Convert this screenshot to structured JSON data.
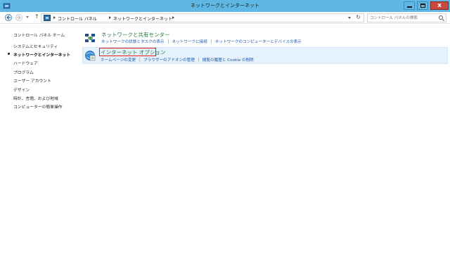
{
  "window": {
    "title": "ネットワークとインターネット",
    "close_label": "x"
  },
  "address": {
    "crumbs": [
      "コントロール パネル",
      "ネットワークとインターネット"
    ],
    "search_placeholder": "コントロール パネルの検索"
  },
  "sidebar": {
    "items": [
      {
        "label": "コントロール パネル ホーム"
      },
      {
        "label": "システムとセキュリティ"
      },
      {
        "label": "ネットワークとインターネット",
        "current": true
      },
      {
        "label": "ハードウェア"
      },
      {
        "label": "プログラム"
      },
      {
        "label": "ユーザー アカウント"
      },
      {
        "label": "デザイン"
      },
      {
        "label": "時計、言語、および地域"
      },
      {
        "label": "コンピューターの簡単操作"
      }
    ]
  },
  "categories": [
    {
      "title": "ネットワークと共有センター",
      "icon": "network-sharing-icon",
      "links": [
        "ネットワークの状態とタスクの表示",
        "ネットワークに接続",
        "ネットワークのコンピューターとデバイスの表示"
      ]
    },
    {
      "title": "インターネット オプション",
      "icon": "internet-options-icon",
      "links": [
        "ホームページの変更",
        "ブラウザーのアドオンの管理",
        "閲覧の履歴と Cookie の削除"
      ]
    }
  ],
  "colors": {
    "titlebar": "#5fb8e4",
    "category_title": "#1e7a37",
    "link": "#1c56a6",
    "highlight": "#e01b1b",
    "hover_bg": "#e5f1fb"
  }
}
